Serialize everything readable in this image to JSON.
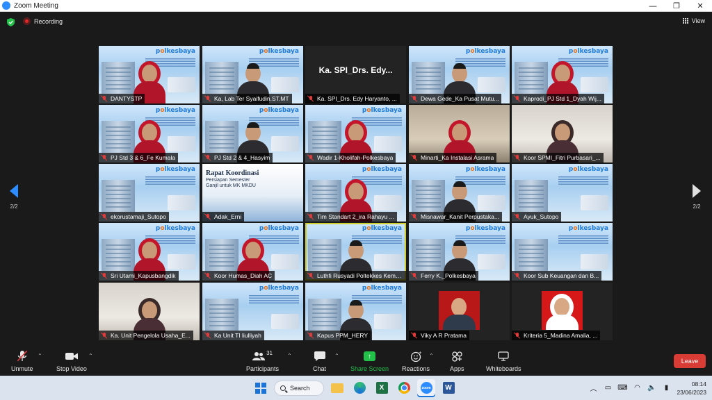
{
  "window": {
    "title": "Zoom Meeting",
    "logo_text": "zoom",
    "minimize": "—",
    "maximize": "❐",
    "close": "✕"
  },
  "meeting": {
    "recording_label": "Recording",
    "view_label": "View"
  },
  "tiles": [
    {
      "name": "DANTYSTP"
    },
    {
      "name": "Ka, Lab Ter Syaifudin.ST.MT"
    },
    {
      "name": "Ka. SPI_Drs. Edy Haryanto, ...",
      "display_name": "Ka. SPI_Drs. Edy..."
    },
    {
      "name": "Dewa Gede_Ka Pusat Mutu..."
    },
    {
      "name": "Kaprodi_PJ Std 1_Dyah Wij..."
    },
    {
      "name": "PJ Std 3 & 6_Fe Kumala"
    },
    {
      "name": "PJ Std 2 & 4_Hasyim"
    },
    {
      "name": "Wadir 1-Kholifah-Polkesbaya"
    },
    {
      "name": "Minarti_Ka Instalasi Asrama"
    },
    {
      "name": "Koor SPMI_Fitri Purbasari_..."
    },
    {
      "name": "ekorustamaji_Sutopo"
    },
    {
      "name": "Adak_Erni",
      "slide_title": "Rapat Koordinasi",
      "slide_sub": "Persiapan Semester Ganjil untuk MK MKDU"
    },
    {
      "name": "Tim Standart 2_ira Rahayu ..."
    },
    {
      "name": "Misnawar_Kanit Perpustaka..."
    },
    {
      "name": "Ayuk_Sutopo"
    },
    {
      "name": "Sri Utami_Kapusbangdik"
    },
    {
      "name": "Koor Humas_Diah AC"
    },
    {
      "name": "Luthfi Rusyadi Poltekkes Keme..."
    },
    {
      "name": "Ferry K._Polkesbaya"
    },
    {
      "name": "Koor Sub Keuangan dan B..."
    },
    {
      "name": "Ka. Unit Pengelola Usaha_E..."
    },
    {
      "name": "Ka Unit TI liulliyah"
    },
    {
      "name": "Kapus PPM_HERY"
    },
    {
      "name": "Viky A R Pratama"
    },
    {
      "name": "Kriteria 5_Madina Amalia, ..."
    }
  ],
  "banner_logo": {
    "part1": "p",
    "part2": "lkesbaya",
    "accent": "o"
  },
  "pagination": {
    "left": "2/2",
    "right": "2/2"
  },
  "toolbar": {
    "unmute": "Unmute",
    "stop_video": "Stop Video",
    "participants": "Participants",
    "participant_count": "31",
    "chat": "Chat",
    "share_screen": "Share Screen",
    "reactions": "Reactions",
    "apps": "Apps",
    "whiteboards": "Whiteboards",
    "leave": "Leave"
  },
  "taskbar": {
    "search_label": "Search",
    "time": "08:14",
    "date": "23/06/2023",
    "excel_letter": "X",
    "word_letter": "W",
    "zoom_text": "zoom"
  },
  "colors": {
    "zoom_blue": "#2d8cff",
    "share_green": "#23c14a",
    "leave_red": "#d93b35",
    "mute_red": "#e23b3b"
  }
}
